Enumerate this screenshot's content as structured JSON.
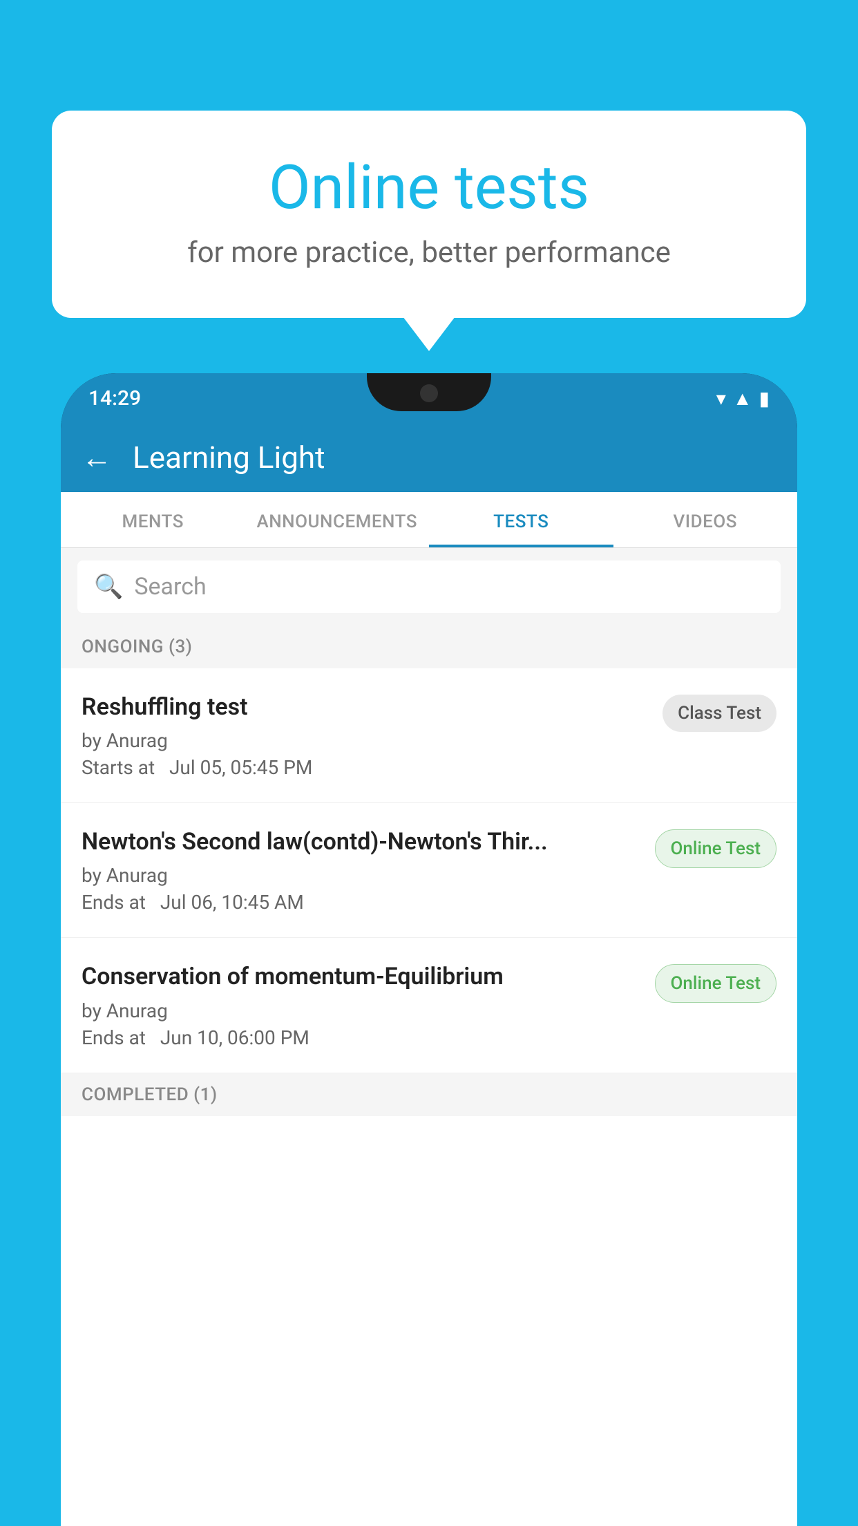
{
  "background": {
    "color": "#1ab8e8"
  },
  "speech_bubble": {
    "title": "Online tests",
    "subtitle": "for more practice, better performance"
  },
  "phone": {
    "status_bar": {
      "time": "14:29",
      "wifi_icon": "wifi-icon",
      "signal_icon": "signal-icon",
      "battery_icon": "battery-icon"
    },
    "app_header": {
      "back_icon": "←",
      "title": "Learning Light"
    },
    "tabs": [
      {
        "label": "MENTS",
        "active": false
      },
      {
        "label": "ANNOUNCEMENTS",
        "active": false
      },
      {
        "label": "TESTS",
        "active": true
      },
      {
        "label": "VIDEOS",
        "active": false
      }
    ],
    "search": {
      "placeholder": "Search"
    },
    "ongoing_section": {
      "label": "ONGOING (3)"
    },
    "test_items": [
      {
        "title": "Reshuffling test",
        "author": "by Anurag",
        "time_label": "Starts at",
        "time": "Jul 05, 05:45 PM",
        "badge": "Class Test",
        "badge_type": "class"
      },
      {
        "title": "Newton's Second law(contd)-Newton's Thir...",
        "author": "by Anurag",
        "time_label": "Ends at",
        "time": "Jul 06, 10:45 AM",
        "badge": "Online Test",
        "badge_type": "online"
      },
      {
        "title": "Conservation of momentum-Equilibrium",
        "author": "by Anurag",
        "time_label": "Ends at",
        "time": "Jun 10, 06:00 PM",
        "badge": "Online Test",
        "badge_type": "online"
      }
    ],
    "completed_section": {
      "label": "COMPLETED (1)"
    }
  }
}
